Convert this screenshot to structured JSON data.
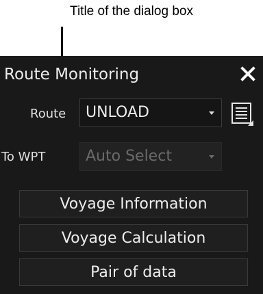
{
  "annotation": {
    "label": "Title of the dialog box"
  },
  "dialog": {
    "title": "Route Monitoring",
    "close_icon": "close-icon",
    "route": {
      "label": "Route",
      "value": "UNLOAD"
    },
    "route_list_icon": "list-icon",
    "to_wpt": {
      "label": "To WPT",
      "value": "Auto Select",
      "disabled": true
    },
    "buttons": [
      "Voyage Information",
      "Voyage Calculation",
      "Pair of data"
    ]
  },
  "colors": {
    "panel": "#191919",
    "text": "#ededed",
    "disabled_text": "#6a6a6a"
  }
}
